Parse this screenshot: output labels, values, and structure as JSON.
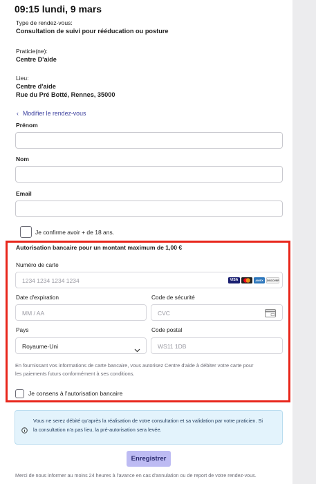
{
  "appointment": {
    "datetime": "09:15 lundi, 9 mars",
    "type_label": "Type de rendez-vous:",
    "type_value": "Consultation de suivi pour rééducation ou posture",
    "practitioner_label": "Praticie(ne):",
    "practitioner_value": "Centre D'aide",
    "location_label": "Lieu:",
    "location_name": "Centre d'aide",
    "location_address": "Rue du Pré Botté, Rennes, 35000",
    "modify_link": "Modifier le rendez-vous"
  },
  "form": {
    "first_name_label": "Prénom",
    "first_name_value": "",
    "last_name_label": "Nom",
    "last_name_value": "",
    "email_label": "Email",
    "email_value": "",
    "age_confirm_label": "Je confirme avoir + de 18 ans.",
    "age_confirm_checked": false
  },
  "payment": {
    "title": "Autorisation bancaire pour un montant maximum de 1,00 €",
    "card_number_label": "Numéro de carte",
    "card_number_placeholder": "1234 1234 1234 1234",
    "card_brands": [
      "VISA",
      "MC",
      "AMEX",
      "DISCOVER"
    ],
    "expiry_label": "Date d'expiration",
    "expiry_placeholder": "MM / AA",
    "cvc_label": "Code de sécurité",
    "cvc_placeholder": "CVC",
    "country_label": "Pays",
    "country_value": "Royaume-Uni",
    "postal_label": "Code postal",
    "postal_placeholder": "WS11 1DB",
    "disclaimer_line1": "En fournissant vos informations de carte bancaire, vous autorisez Centre d'aide à débiter votre carte pour",
    "disclaimer_line2": "les paiements futurs conformément à ses conditions.",
    "consent_label": "Je consens à l'autorisation bancaire",
    "consent_checked": false
  },
  "notice": {
    "line1": "Vous ne serez débité qu'après la réalisation de votre consultation et sa validation par votre praticien. Si",
    "line2": "la consultation n'a pas lieu, la pré-autorisation sera levée."
  },
  "submit_label": "Enregistrer",
  "footer_text": "Merci de nous informer au moins 24 heures à l'avance en cas d'annulation ou de report de votre rendez-vous.",
  "colors": {
    "highlight_border": "#e8261b",
    "submit_button": "#bdbbf3",
    "notice_background": "#e3f3fc",
    "link": "#3b3f9e"
  }
}
